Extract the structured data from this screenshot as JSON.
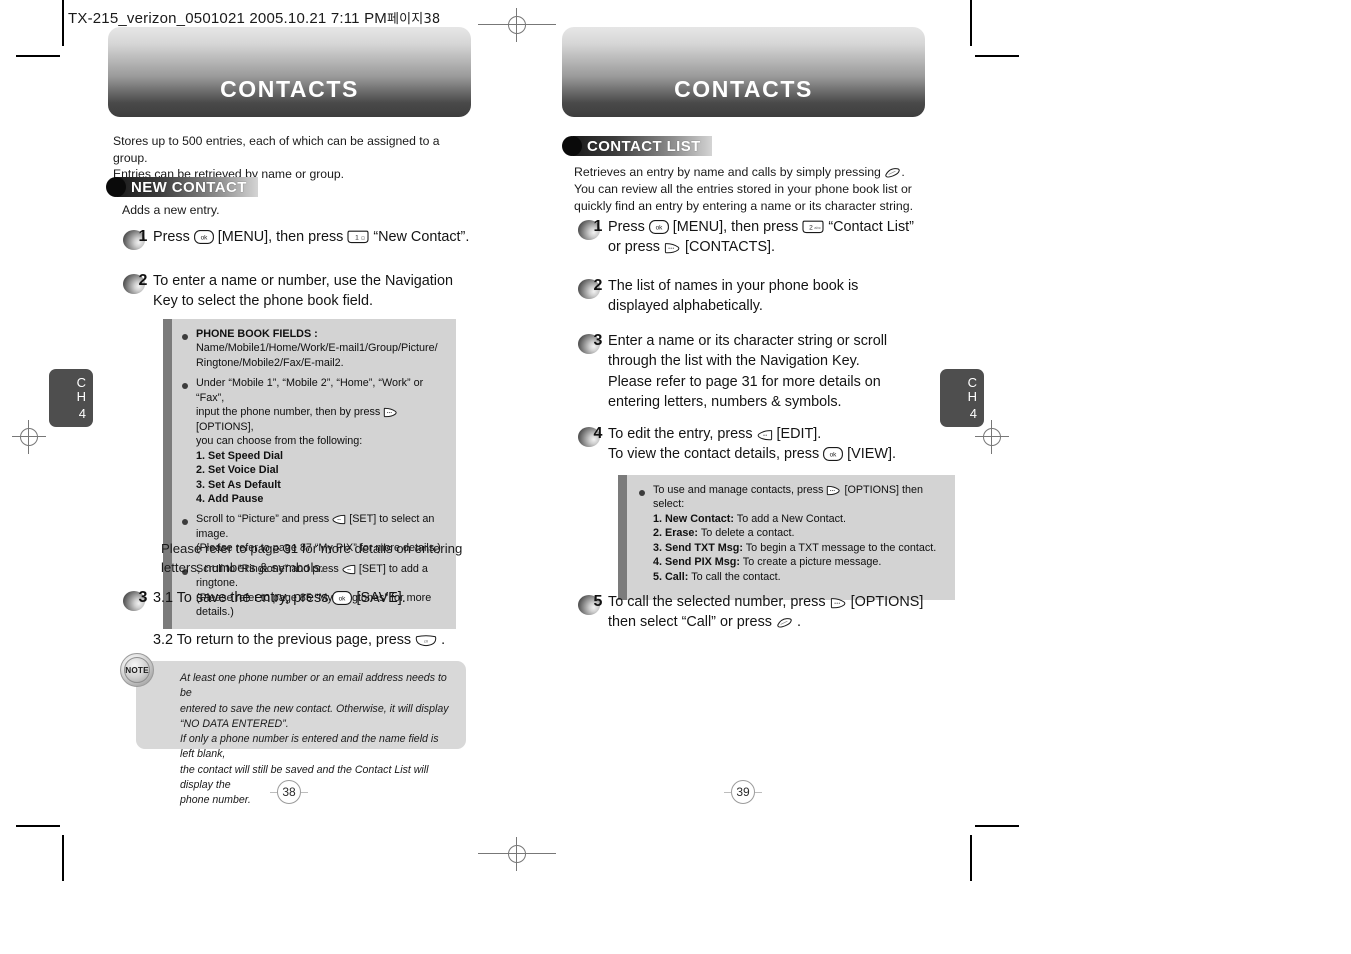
{
  "proof_header": {
    "file": "TX-215_verizon_0501021  2005.10.21  7:11 PM",
    "korean_suffix": "페이지38"
  },
  "left_page": {
    "banner_title": "CONTACTS",
    "chapter_tab": {
      "line1": "C",
      "line2": "H",
      "number": "4"
    },
    "page_number": "38",
    "lead_text": "Stores up to 500 entries, each of which can be assigned to a group.\nEntries can be retrieved by name or group.",
    "section_header": "NEW CONTACT",
    "section_subtitle": "Adds a new entry.",
    "steps": [
      {
        "number": "1",
        "parts": [
          {
            "type": "text",
            "value": "Press "
          },
          {
            "type": "key",
            "value": "ok-key"
          },
          {
            "type": "text",
            "value": " [MENU], then press "
          },
          {
            "type": "key",
            "value": "num1-key"
          },
          {
            "type": "text",
            "value": " “New Contact”."
          }
        ],
        "plain": "Press [MENU], then press “New Contact”."
      },
      {
        "number": "2",
        "plain": "To enter a name or number, use the Navigation\nKey to select the phone book field."
      },
      {
        "number": "3",
        "line1": "3.1 To save the entry, press",
        "line1_end": "[SAVE].",
        "line2": "3.2 To return to the previous page, press",
        "line2_end": "."
      }
    ],
    "info_box": {
      "items": [
        {
          "title": "PHONE BOOK FIELDS :",
          "lines": [
            "Name/Mobile1/Home/Work/E-mail1/Group/Picture/",
            "Ringtone/Mobile2/Fax/E-mail2."
          ]
        },
        {
          "lines_pre": [
            "Under “Mobile 1”, “Mobile 2”, “Home”, “Work” or “Fax”,",
            "input the phone number, then by press"
          ],
          "options_label": "[OPTIONS],",
          "line_after": "you can choose from the following:",
          "numbered": [
            "1. Set Speed Dial",
            "2. Set Voice Dial",
            "3. Set As Default",
            "4. Add Pause"
          ]
        },
        {
          "pre": "Scroll to “Picture” and press",
          "post": "[SET] to select an image.",
          "note": "(Please refer to page 87 “My PIX” for more details.)"
        },
        {
          "pre": "Scroll to “Ringtone” and press",
          "post": "[SET] to add a ringtone.",
          "note": "(Please refer to page 85 “My Ringtones” for more details.)"
        }
      ]
    },
    "refer_text": "Please refer to page 31 for more details on entering\nletters, numbers & symbols.",
    "note_box": {
      "badge_label": "NOTE",
      "text": "At least one phone number or an email address needs to  be\nentered to save the new contact. Otherwise, it will display\n“NO DATA ENTERED”.\nIf only a phone number is entered and the name field is left blank,\nthe contact will still be saved and the Contact List will display the\nphone number."
    }
  },
  "right_page": {
    "banner_title": "CONTACTS",
    "chapter_tab": {
      "line1": "C",
      "line2": "H",
      "number": "4"
    },
    "page_number": "39",
    "section_header": "CONTACT LIST",
    "lead_line1_pre": "Retrieves an entry by name and calls by simply pressing",
    "lead_line1_post": ".",
    "lead_rest": "You can review all the entries stored in your phone book list or\nquickly find an entry by entering a name or its character string.",
    "steps": [
      {
        "number": "1",
        "line1_a": "Press",
        "line1_b": "[MENU], then press",
        "line1_c": "“Contact List”",
        "line2_a": "or press",
        "line2_b": "[CONTACTS]."
      },
      {
        "number": "2",
        "plain": "The list of names in your phone book is\ndisplayed alphabetically."
      },
      {
        "number": "3",
        "plain": "Enter a name or its character string or scroll\nthrough the list with the Navigation Key.\nPlease refer to page 31 for more details on\nentering letters, numbers & symbols."
      },
      {
        "number": "4",
        "line1_a": "To edit the entry, press",
        "line1_b": "[EDIT].",
        "line2_a": "To view the contact details, press",
        "line2_b": "[VIEW]."
      },
      {
        "number": "5",
        "line1_a": "To call the selected number, press",
        "line1_b": "[OPTIONS]",
        "line2_a": "then select “Call” or press",
        "line2_b": "."
      }
    ],
    "info_box": {
      "intro_pre": "To use and manage contacts, press",
      "intro_post": "[OPTIONS] then select:",
      "options": [
        {
          "label": "1. New Contact:",
          "desc": " To add a New Contact."
        },
        {
          "label": "2. Erase:",
          "desc": " To delete a contact."
        },
        {
          "label": "3. Send TXT Msg:",
          "desc": " To begin a TXT message to the contact."
        },
        {
          "label": "4. Send PIX Msg:",
          "desc": " To create a picture message."
        },
        {
          "label": "5. Call:",
          "desc": " To call the contact."
        }
      ]
    }
  },
  "colors": {
    "banner_dark": "#3d3d3d",
    "banner_light": "#e6e6e6",
    "infobox_bg": "#d3d3d3",
    "infobox_bar": "#7b7b7b",
    "notebox_bg": "#d8d8d8",
    "chapter_tab": "#4e4e4e",
    "text": "#1a1a1a"
  }
}
